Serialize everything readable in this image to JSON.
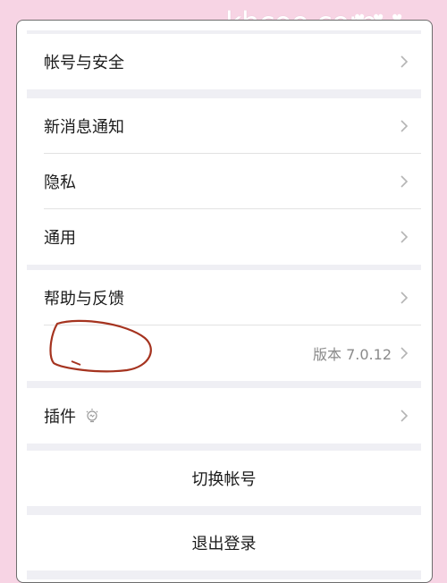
{
  "watermark": "khcoo.com",
  "settings": {
    "account_security": "帐号与安全",
    "notifications": "新消息通知",
    "privacy": "隐私",
    "general": "通用",
    "help_feedback": "帮助与反馈",
    "version_label": "版本 7.0.12",
    "plugins": "插件",
    "switch_account": "切换帐号",
    "log_out": "退出登录"
  },
  "icons": {
    "chevron": "chevron-right-icon",
    "bulb": "lightbulb-icon"
  },
  "colors": {
    "page_bg": "#f7d4e4",
    "screen_bg": "#efeff4",
    "text": "#1c1c1c",
    "muted": "#8a8a8a",
    "scribble": "#a5331f"
  }
}
